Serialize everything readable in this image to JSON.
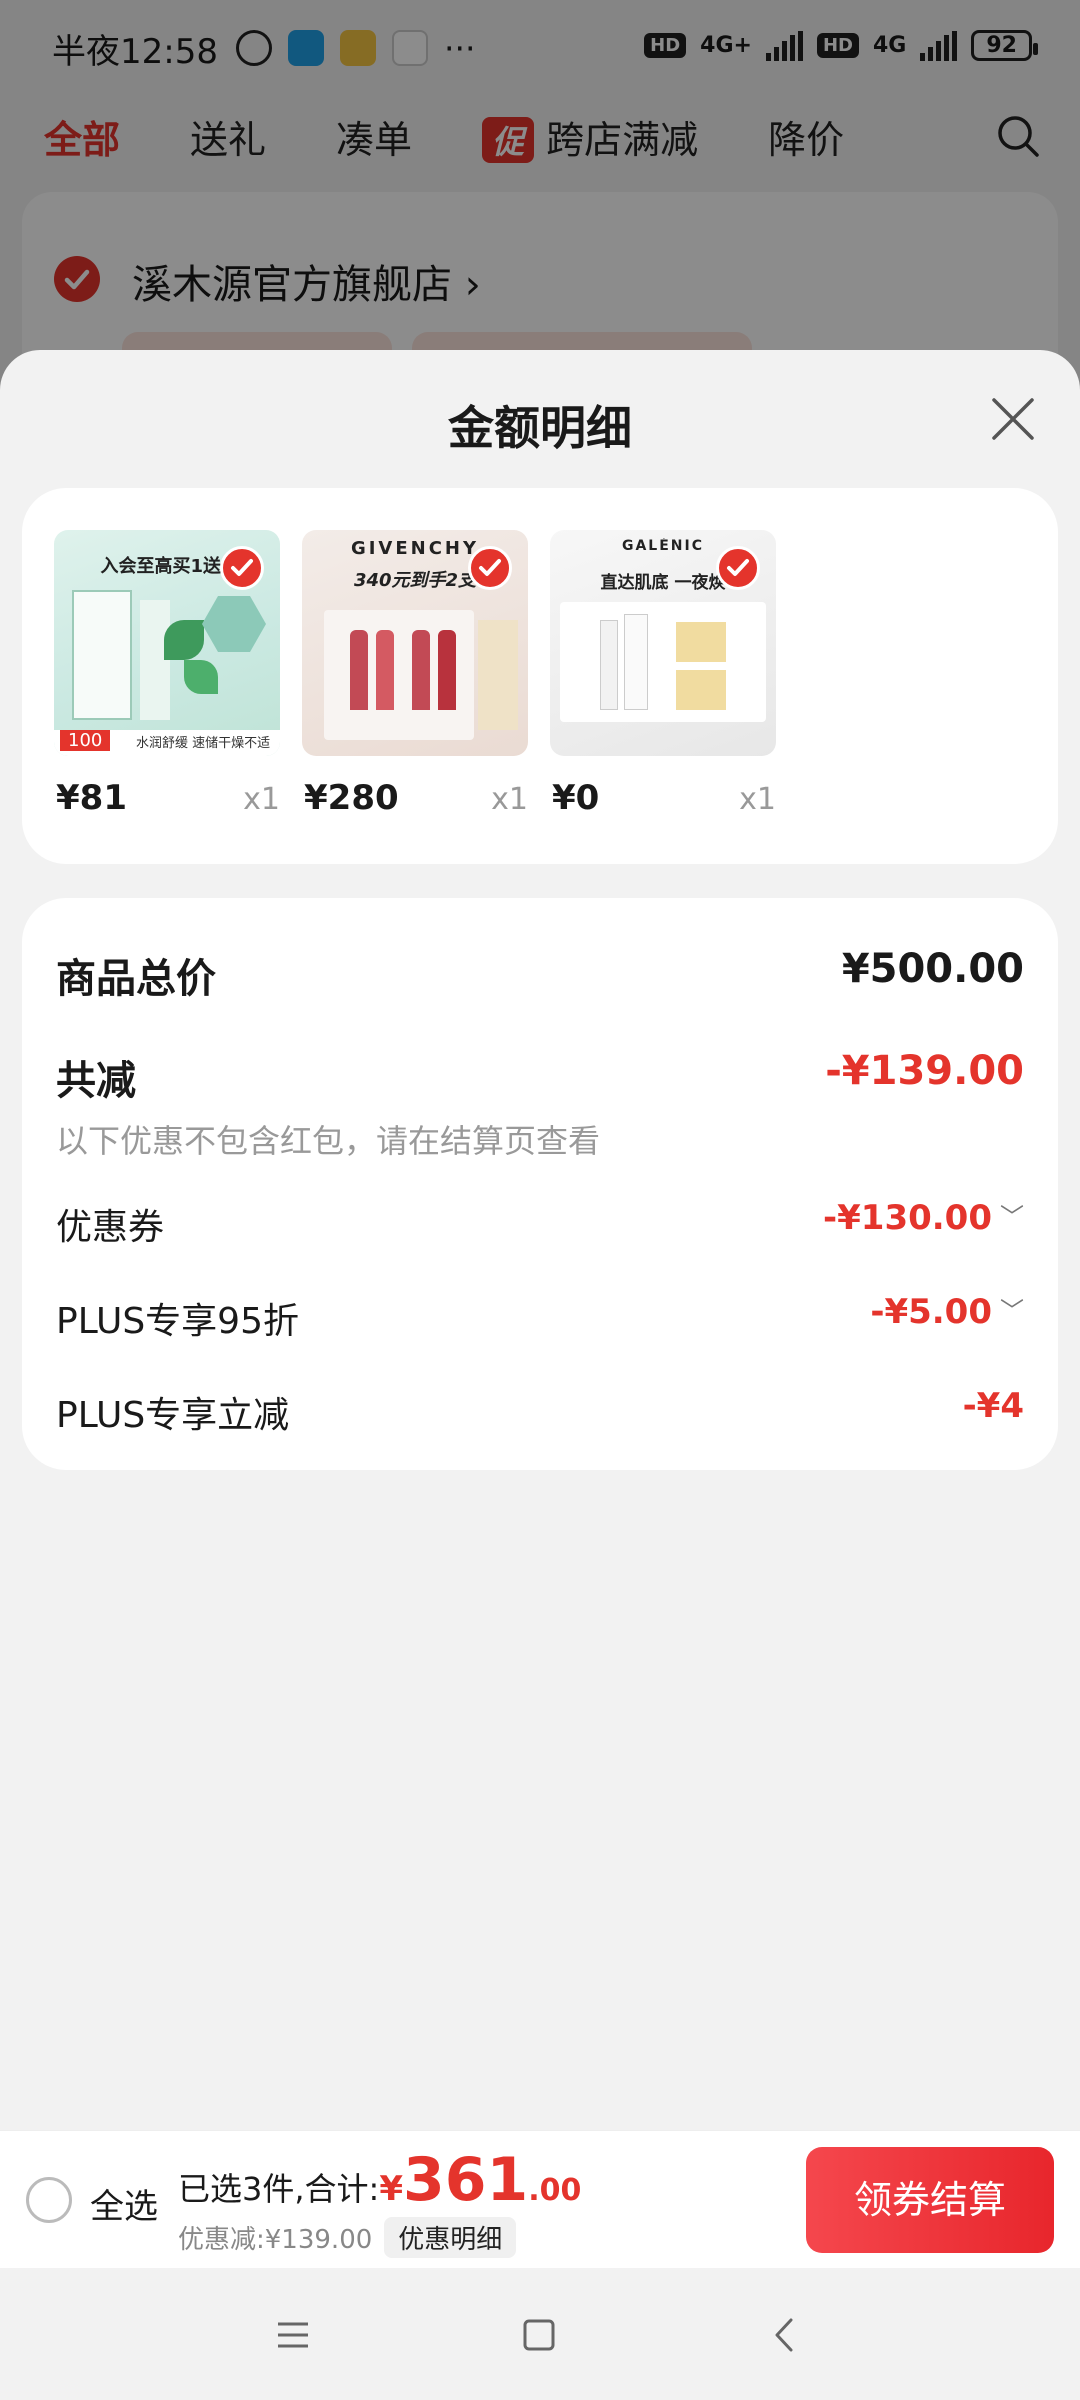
{
  "status_bar": {
    "time": "半夜12:58",
    "more": "···",
    "network1": "4G+",
    "network2": "4G",
    "hd": "HD",
    "battery": "92"
  },
  "top_tabs": [
    {
      "label": "全部",
      "active": true
    },
    {
      "label": "送礼"
    },
    {
      "label": "凑单"
    },
    {
      "label": "跨店满减",
      "badge": "促"
    },
    {
      "label": "降价"
    }
  ],
  "store": {
    "name": "溪木源官方旗舰店"
  },
  "sheet": {
    "title": "金额明细",
    "items": [
      {
        "price": "¥81",
        "qty": "x1",
        "thumb_text_top": "入会至高买1送1",
        "thumb_text_bottom": "水润舒缓 速储干燥不适",
        "thumb_tag": "100"
      },
      {
        "price": "¥280",
        "qty": "x1",
        "thumb_text_top": "GIVENCHY",
        "thumb_text_mid": "340元到手2支"
      },
      {
        "price": "¥0",
        "qty": "x1",
        "thumb_text_top": "GALÉNIC",
        "thumb_text_mid": "直达肌底 一夜焕"
      }
    ],
    "summary": {
      "goods_total_label": "商品总价",
      "goods_total_value": "¥500.00",
      "reduction_label": "共减",
      "reduction_value": "-¥139.00",
      "note": "以下优惠不包含红包，请在结算页查看",
      "rows": [
        {
          "label": "优惠券",
          "value": "-¥130.00",
          "expandable": true
        },
        {
          "label": "PLUS专享95折",
          "value": "-¥5.00",
          "expandable": true
        },
        {
          "label": "PLUS专享立减",
          "value": "-¥4",
          "expandable": false
        }
      ]
    }
  },
  "checkout": {
    "select_all": "全选",
    "selected_text": "已选3件,合计:",
    "currency": "¥",
    "total_int": "361",
    "total_dec": ".00",
    "discount_text": "优惠减:¥139.00",
    "detail_chip": "优惠明细",
    "button": "领券结算"
  },
  "colors": {
    "accent": "#e4342c",
    "button_gradient": [
      "#f5474d",
      "#e8262c"
    ]
  }
}
